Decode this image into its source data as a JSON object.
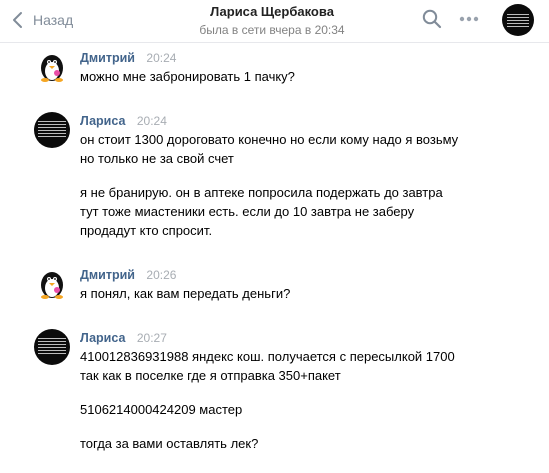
{
  "header": {
    "back_label": "Назад",
    "title": "Лариса Щербакова",
    "status": "была в сети вчера в 20:34",
    "icons": [
      "chevron-left-icon",
      "search-icon",
      "more-icon"
    ]
  },
  "colors": {
    "accent_name": "#42648b",
    "muted": "#828282",
    "divider": "#e7e8ec"
  },
  "messages": [
    {
      "author": "Дмитрий",
      "time": "20:24",
      "avatar": "penguin",
      "paragraphs": [
        "можно мне забронировать 1 пачку?"
      ]
    },
    {
      "author": "Лариса",
      "time": "20:24",
      "avatar": "dark",
      "paragraphs": [
        "он стоит 1300 дороговато конечно но если кому надо я возьму\nно только не за свой счет",
        "я не бранирую. он в аптеке попросила подержать до завтра\nтут тоже миастеники есть. если до 10 завтра не заберу\nпродадут кто спросит."
      ]
    },
    {
      "author": "Дмитрий",
      "time": "20:26",
      "avatar": "penguin",
      "paragraphs": [
        "я понял, как вам передать деньги?"
      ]
    },
    {
      "author": "Лариса",
      "time": "20:27",
      "avatar": "dark",
      "paragraphs": [
        "410012836931988 яндекс кош. получается с пересылкой 1700\nтак как в поселке где я отправка 350+пакет",
        "5106214000424209 мастер",
        "тогда за вами оставлять лек?"
      ]
    }
  ]
}
